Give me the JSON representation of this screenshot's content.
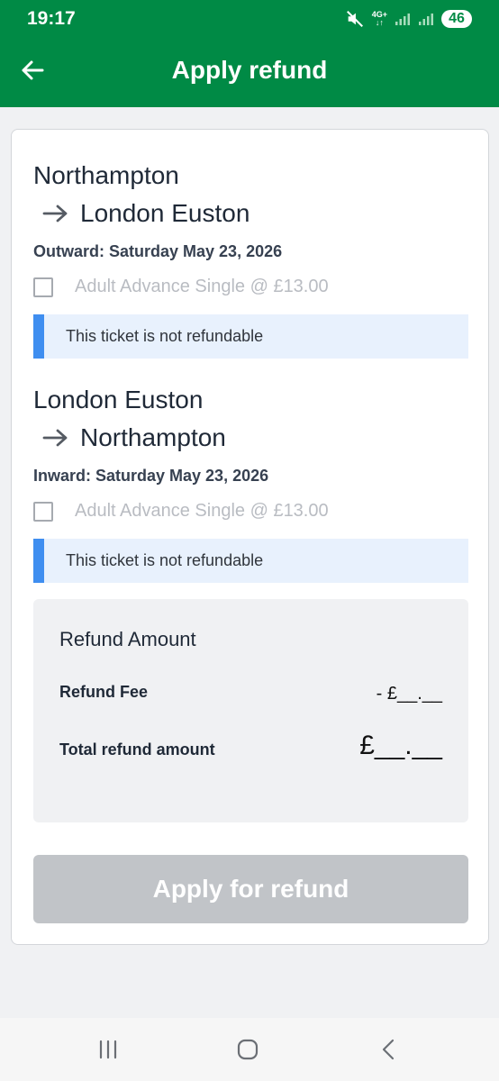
{
  "status_bar": {
    "time": "19:17",
    "network_label": "4G+",
    "battery": "46",
    "icons": [
      "mute-icon",
      "signal-icon",
      "signal-icon"
    ]
  },
  "header": {
    "title": "Apply refund",
    "back_icon": "arrow-left-icon",
    "background_color": "#008a45"
  },
  "journeys": [
    {
      "from": "Northampton",
      "to": "London Euston",
      "date_label": "Outward: Saturday May 23, 2026",
      "ticket_label": "Adult Advance Single @ £13.00",
      "checked": false,
      "notice": "This ticket is not refundable"
    },
    {
      "from": "London Euston",
      "to": "Northampton",
      "date_label": "Inward: Saturday May 23, 2026",
      "ticket_label": "Adult Advance Single @ £13.00",
      "checked": false,
      "notice": "This ticket is not refundable"
    }
  ],
  "refund": {
    "heading": "Refund Amount",
    "fee_label": "Refund Fee",
    "fee_value": "- £__.__",
    "total_label": "Total refund amount",
    "total_value": "£__.__"
  },
  "actions": {
    "apply_label": "Apply for refund",
    "apply_enabled": false
  },
  "nav_bar": {
    "icons": [
      "recent-apps-icon",
      "home-icon",
      "back-icon"
    ]
  },
  "colors": {
    "brand_green": "#008a45",
    "notice_accent": "#3f8ef0",
    "disabled_button": "#c1c4c8"
  }
}
